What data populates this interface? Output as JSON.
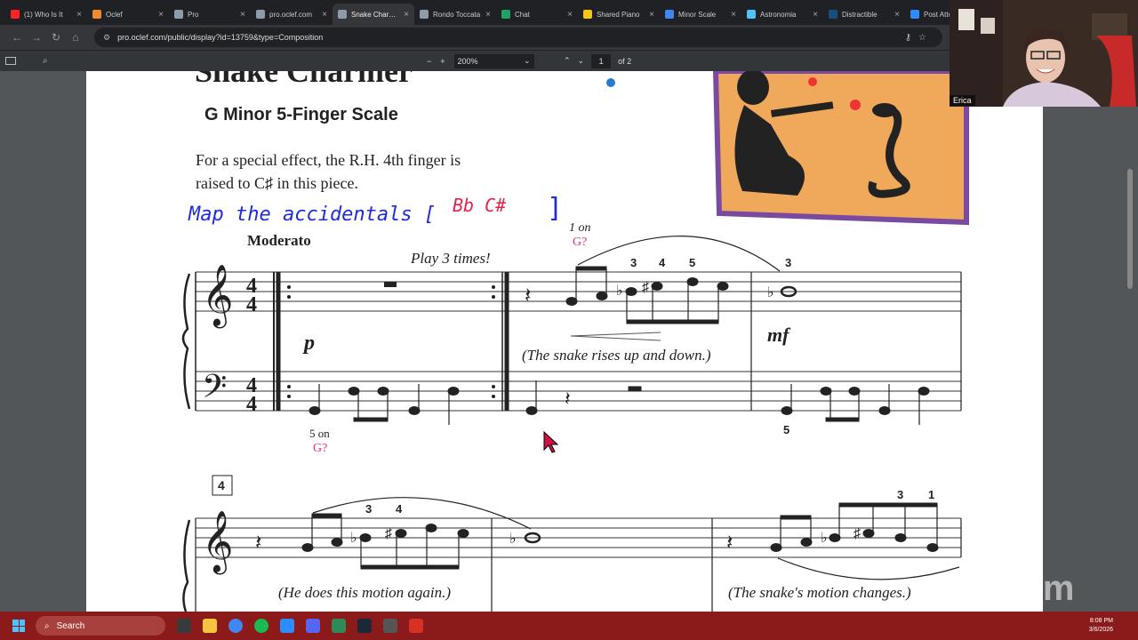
{
  "tabs": [
    {
      "title": "(1) Who Is It",
      "color": "#ff2222"
    },
    {
      "title": "Oclef",
      "color": "#f08a2c"
    },
    {
      "title": "Pro",
      "color": "#8f9ba8"
    },
    {
      "title": "pro.oclef.com",
      "color": "#8f9ba8"
    },
    {
      "title": "Snake Charmer",
      "color": "#8f9ba8"
    },
    {
      "title": "Rondo Toccata",
      "color": "#8f9ba8"
    },
    {
      "title": "Chat",
      "color": "#1fa463"
    },
    {
      "title": "Shared Piano",
      "color": "#f5c518"
    },
    {
      "title": "Minor Scale",
      "color": "#4285f4"
    },
    {
      "title": "Astronomia",
      "color": "#4fc3f7"
    },
    {
      "title": "Distractible",
      "color": "#1a4d7c"
    },
    {
      "title": "Post Attendee",
      "color": "#2d8cff"
    }
  ],
  "active_tab": 4,
  "address": {
    "url": "pro.oclef.com/public/display?id=13759&type=Composition"
  },
  "pdf_toolbar": {
    "zoom": "200%",
    "page": "1",
    "of_pages": "of 2"
  },
  "score": {
    "title": "Snake Charmer",
    "subtitle": "G Minor 5-Finger Scale",
    "instruction_line1": "For a special effect, the R.H. 4th finger is",
    "instruction_line2": "raised to C♯ in this piece.",
    "handwritten_prefix": "Map the accidentals [",
    "handwritten_accidentals": "Bb  C#",
    "handwritten_suffix": "]",
    "tempo": "Moderato",
    "repeat_note": "Play 3 times!",
    "dynamic_p": "p",
    "dynamic_mf": "mf",
    "caption1": "(The snake rises up and down.)",
    "caption2": "(He does this motion again.)",
    "caption3": "(The snake's motion changes.)",
    "measure_number": "4",
    "annot_top": "1 on",
    "annot_top_note": "G?",
    "annot_bottom": "5 on",
    "annot_bottom_note": "G?",
    "time_top": "4",
    "time_bottom": "4",
    "fingerings": [
      "3",
      "4",
      "5",
      "3",
      "5",
      "3",
      "4",
      "3",
      "1"
    ]
  },
  "webcam": {
    "name": "Erica"
  },
  "taskbar": {
    "search": "Search",
    "time": "8:08 PM",
    "date": "3/6/2026"
  },
  "watermark": "zoom"
}
